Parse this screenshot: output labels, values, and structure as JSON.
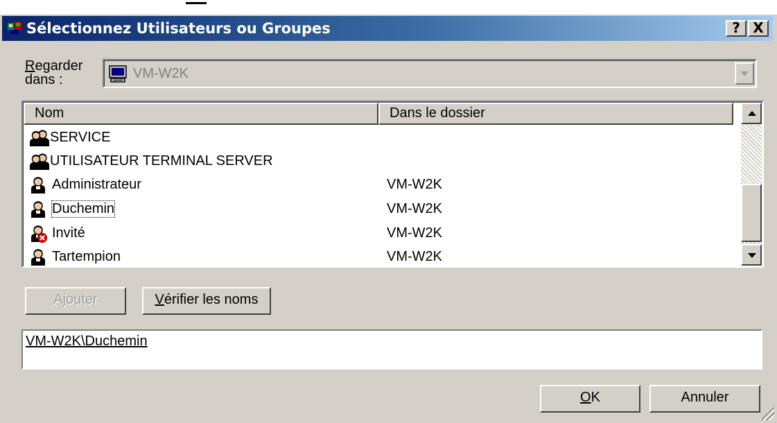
{
  "window": {
    "title": "Sélectionnez Utilisateurs ou Groupes",
    "help_button": "?",
    "close_button": "X"
  },
  "look_in": {
    "label_line1": "Regarder",
    "label_line2": "dans :",
    "mnemonic": "R",
    "value": "VM-W2K",
    "icon": "computer-icon"
  },
  "list": {
    "columns": [
      "Nom",
      "Dans le dossier"
    ],
    "rows": [
      {
        "name": "SERVICE",
        "folder": "",
        "icon": "group-icon"
      },
      {
        "name": "UTILISATEUR TERMINAL SERVER",
        "folder": "",
        "icon": "group-icon"
      },
      {
        "name": "Administrateur",
        "folder": "VM-W2K",
        "icon": "user-icon"
      },
      {
        "name": "Duchemin",
        "folder": "VM-W2K",
        "icon": "user-icon",
        "selected": true
      },
      {
        "name": "Invité",
        "folder": "VM-W2K",
        "icon": "disabled-user-icon"
      },
      {
        "name": "Tartempion",
        "folder": "VM-W2K",
        "icon": "user-icon"
      }
    ]
  },
  "buttons": {
    "add": "Ajouter",
    "check_names": "Vérifier les noms",
    "ok": "OK",
    "cancel": "Annuler"
  },
  "selected_names": "VM-W2K\\Duchemin",
  "colors": {
    "face": "#d4d0c8",
    "titlebar_start": "#0a246a",
    "titlebar_end": "#a6caf0"
  }
}
